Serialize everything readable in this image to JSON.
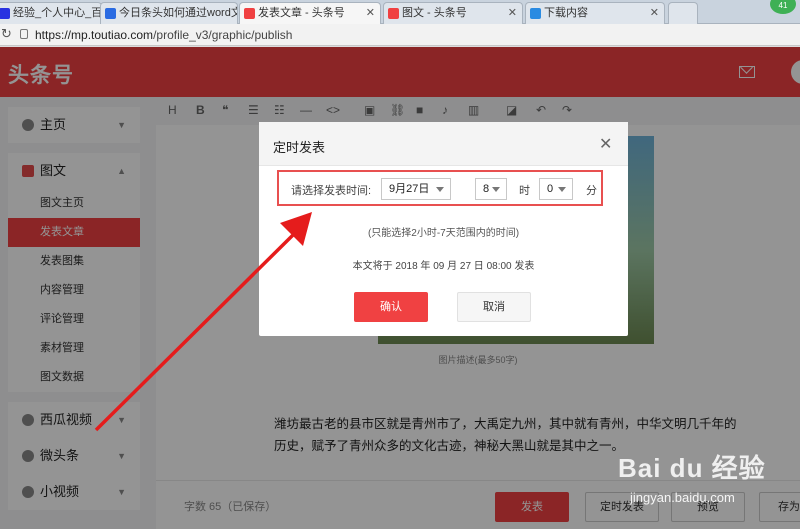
{
  "browser": {
    "tabs": [
      {
        "label": "经验_个人中心_百度",
        "favicon_color": "#2932e1",
        "active": false
      },
      {
        "label": "今日条头如何通过word文",
        "favicon_color": "#2a6be2",
        "active": false
      },
      {
        "label": "发表文章 - 头条号",
        "favicon_color": "#f04142",
        "active": true
      },
      {
        "label": "图文 - 头条号",
        "favicon_color": "#f04142",
        "active": false
      },
      {
        "label": "下载内容",
        "favicon_color": "#2a8be2",
        "active": false
      }
    ],
    "extension_badge": "41",
    "url_host": "https://mp.toutiao.com",
    "url_path": "/profile_v3/graphic/publish"
  },
  "header": {
    "logo": "头条号",
    "brand_color": "#f04142"
  },
  "sidebar": {
    "groups": [
      {
        "label": "主页",
        "icon": "home-icon",
        "expanded": false,
        "items": []
      },
      {
        "label": "图文",
        "icon": "article-icon",
        "expanded": true,
        "items": [
          {
            "label": "图文主页",
            "active": false
          },
          {
            "label": "发表文章",
            "active": true
          },
          {
            "label": "发表图集",
            "active": false
          },
          {
            "label": "内容管理",
            "active": false
          },
          {
            "label": "评论管理",
            "active": false
          },
          {
            "label": "素材管理",
            "active": false
          },
          {
            "label": "图文数据",
            "active": false
          }
        ]
      },
      {
        "label": "西瓜视频",
        "icon": "video-icon",
        "expanded": false,
        "items": []
      },
      {
        "label": "微头条",
        "icon": "microblog-icon",
        "expanded": false,
        "items": []
      },
      {
        "label": "小视频",
        "icon": "short-video-icon",
        "expanded": false,
        "items": []
      }
    ]
  },
  "toolbar": {
    "icons": [
      "heading-icon",
      "bold-icon",
      "quote-icon",
      "unordered-list-icon",
      "ordered-list-icon",
      "divider-icon",
      "code-icon",
      "image-icon",
      "link-icon",
      "video-icon",
      "audio-icon",
      "chart-icon",
      "eraser-icon",
      "undo-icon",
      "redo-icon"
    ]
  },
  "editor": {
    "image_caption": "图片描述(最多50字)",
    "body_text": "潍坊最古老的县市区就是青州市了，大禹定九州，其中就有青州，中华文明几千年的历史，赋予了青州众多的文化古迹，神秘大黑山就是其中之一。"
  },
  "footer": {
    "word_count": "字数 65（已保存）",
    "publish_label": "发表",
    "schedule_label": "定时发表",
    "preview_label": "预览",
    "save_label": "存为"
  },
  "modal": {
    "title": "定时发表",
    "time_label": "请选择发表时间:",
    "date_value": "9月27日",
    "hour_value": "8",
    "hour_unit": "时",
    "minute_value": "0",
    "minute_unit": "分",
    "hint": "(只能选择2小时-7天范围内的时间)",
    "publish_note": "本文将于 2018 年 09 月 27 日 08:00 发表",
    "confirm_label": "确认",
    "cancel_label": "取消"
  },
  "watermark": {
    "logo": "Bai du 经验",
    "url": "jingyan.baidu.com"
  }
}
